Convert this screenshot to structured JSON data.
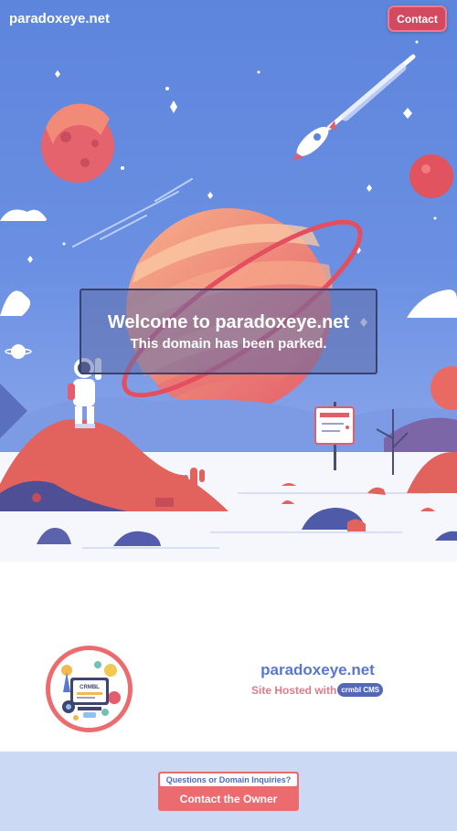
{
  "header": {
    "site_name": "paradoxeye.net",
    "contact_label": "Contact"
  },
  "hero": {
    "title": "Welcome to paradoxeye.net",
    "subtitle": "This domain has been parked."
  },
  "hosting": {
    "domain": "paradoxeye.net",
    "hosted_text": "Site Hosted with",
    "cms_badge": "crmbl CMS",
    "logo_text": "CRMBL"
  },
  "footer": {
    "inquiry_label": "Questions or Domain Inquiries?",
    "contact_owner_label": "Contact the Owner"
  },
  "colors": {
    "sky": "#5c86dd",
    "accent_red": "#ec6b6e",
    "brand_blue": "#5877d3",
    "footer_bg": "#cbd9f4"
  }
}
